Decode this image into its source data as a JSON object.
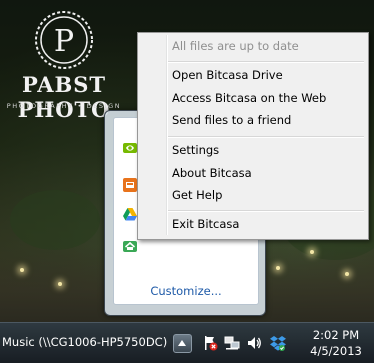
{
  "wallpaper": {
    "logo_initial": "P",
    "brand": "PABST PHOTO",
    "brand_tagline": "PHOTOGRAPHY • DESIGN"
  },
  "context_menu": {
    "status": "All files are up to date",
    "groups": [
      [
        "Open Bitcasa Drive",
        "Access Bitcasa on the Web",
        "Send files to a friend"
      ],
      [
        "Settings",
        "About Bitcasa",
        "Get Help"
      ],
      [
        "Exit Bitcasa"
      ]
    ]
  },
  "overflow_panel": {
    "icons": [
      "nvidia-icon",
      "orange-app-icon",
      "google-drive-icon",
      "bitcasa-icon"
    ],
    "customize_label": "Customize..."
  },
  "taskbar": {
    "active_item": "Music (\\\\CG1006-HP5750DC)",
    "tray_icons": [
      "action-center-flag-icon",
      "network-icon",
      "volume-icon",
      "dropbox-icon"
    ],
    "time": "2:02 PM",
    "date": "4/5/2013"
  },
  "colors": {
    "link": "#1e5aa8",
    "menu_bg": "#f0f0f0",
    "disabled_text": "#8f8f8f",
    "taskbar": "#1e262c"
  }
}
